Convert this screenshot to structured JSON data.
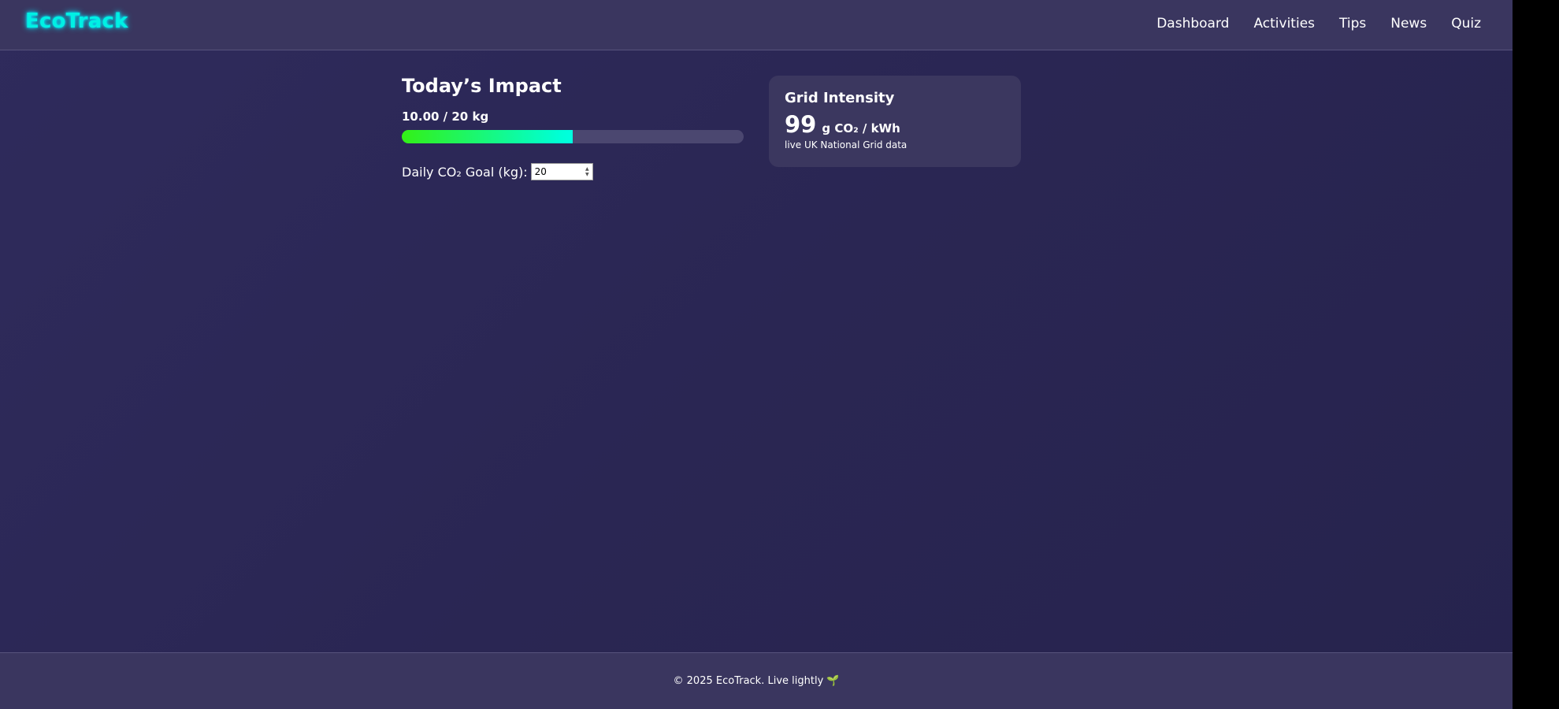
{
  "header": {
    "logo": "EcoTrack",
    "nav": [
      "Dashboard",
      "Activities",
      "Tips",
      "News",
      "Quiz"
    ]
  },
  "impact": {
    "title": "Today’s Impact",
    "amount_text": "10.00 / 20 kg",
    "progress_fraction": 0.5,
    "goal_label": "Daily CO₂ Goal (kg):",
    "goal_value": "20"
  },
  "grid": {
    "title": "Grid Intensity",
    "value": "99",
    "unit": "g CO₂ / kWh",
    "subtitle": "live UK National Grid data"
  },
  "footer": {
    "text": "© 2025 EcoTrack. Live lightly",
    "icon": "sprout-icon"
  },
  "colors": {
    "accent": "#00f0e4",
    "background": "#2a2653",
    "panel": "#3b375f",
    "progress_start": "#33f016",
    "progress_end": "#00ffe0"
  }
}
